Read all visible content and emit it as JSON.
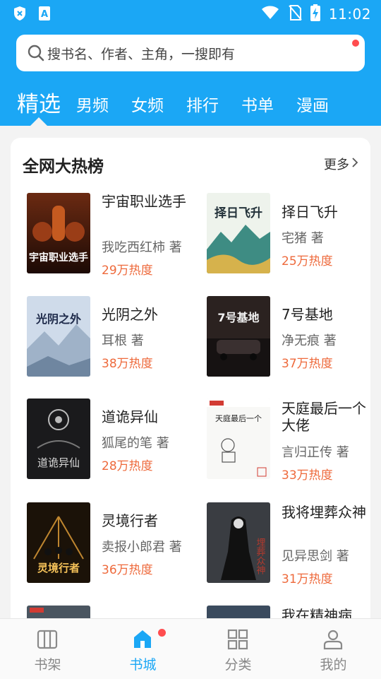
{
  "status_bar": {
    "time": "11:02"
  },
  "search": {
    "placeholder": "搜书名、作者、主角，一搜即有"
  },
  "tabs": [
    {
      "label": "精选",
      "active": true
    },
    {
      "label": "男频"
    },
    {
      "label": "女频"
    },
    {
      "label": "排行"
    },
    {
      "label": "书单"
    },
    {
      "label": "漫画"
    }
  ],
  "section": {
    "title": "全网大热榜",
    "more": "更多"
  },
  "books": [
    {
      "title": "宇宙职业选手",
      "author": "我吃西红柿 著",
      "heat": "29万热度",
      "cover_text": "宇宙职业选手"
    },
    {
      "title": "择日飞升",
      "author": "宅猪 著",
      "heat": "25万热度",
      "cover_text": "择日飞升"
    },
    {
      "title": "光阴之外",
      "author": "耳根 著",
      "heat": "38万热度",
      "cover_text": "光阴之外"
    },
    {
      "title": "7号基地",
      "author": "净无痕 著",
      "heat": "37万热度",
      "cover_text": "7号基地"
    },
    {
      "title": "道诡异仙",
      "author": "狐尾的笔 著",
      "heat": "28万热度",
      "cover_text": "道诡异仙"
    },
    {
      "title": "天庭最后一个大佬",
      "author": "言归正传 著",
      "heat": "33万热度",
      "cover_text": "天庭最后一个"
    },
    {
      "title": "灵境行者",
      "author": "卖报小郎君 著",
      "heat": "36万热度",
      "cover_text": "灵境行者"
    },
    {
      "title": "我将埋葬众神",
      "author": "见异思剑 著",
      "heat": "31万热度",
      "cover_text": "埋葬众神"
    },
    {
      "title": "",
      "author": "",
      "heat": ""
    },
    {
      "title": "我在精神病",
      "author": "",
      "heat": ""
    }
  ],
  "bottom_nav": [
    {
      "label": "书架",
      "icon": "bookshelf-icon"
    },
    {
      "label": "书城",
      "icon": "bookstore-icon",
      "active": true
    },
    {
      "label": "分类",
      "icon": "category-icon"
    },
    {
      "label": "我的",
      "icon": "profile-icon"
    }
  ],
  "colors": {
    "accent": "#1ba7f5",
    "heat": "#ee6a3c",
    "badge": "#ff4d4f"
  }
}
